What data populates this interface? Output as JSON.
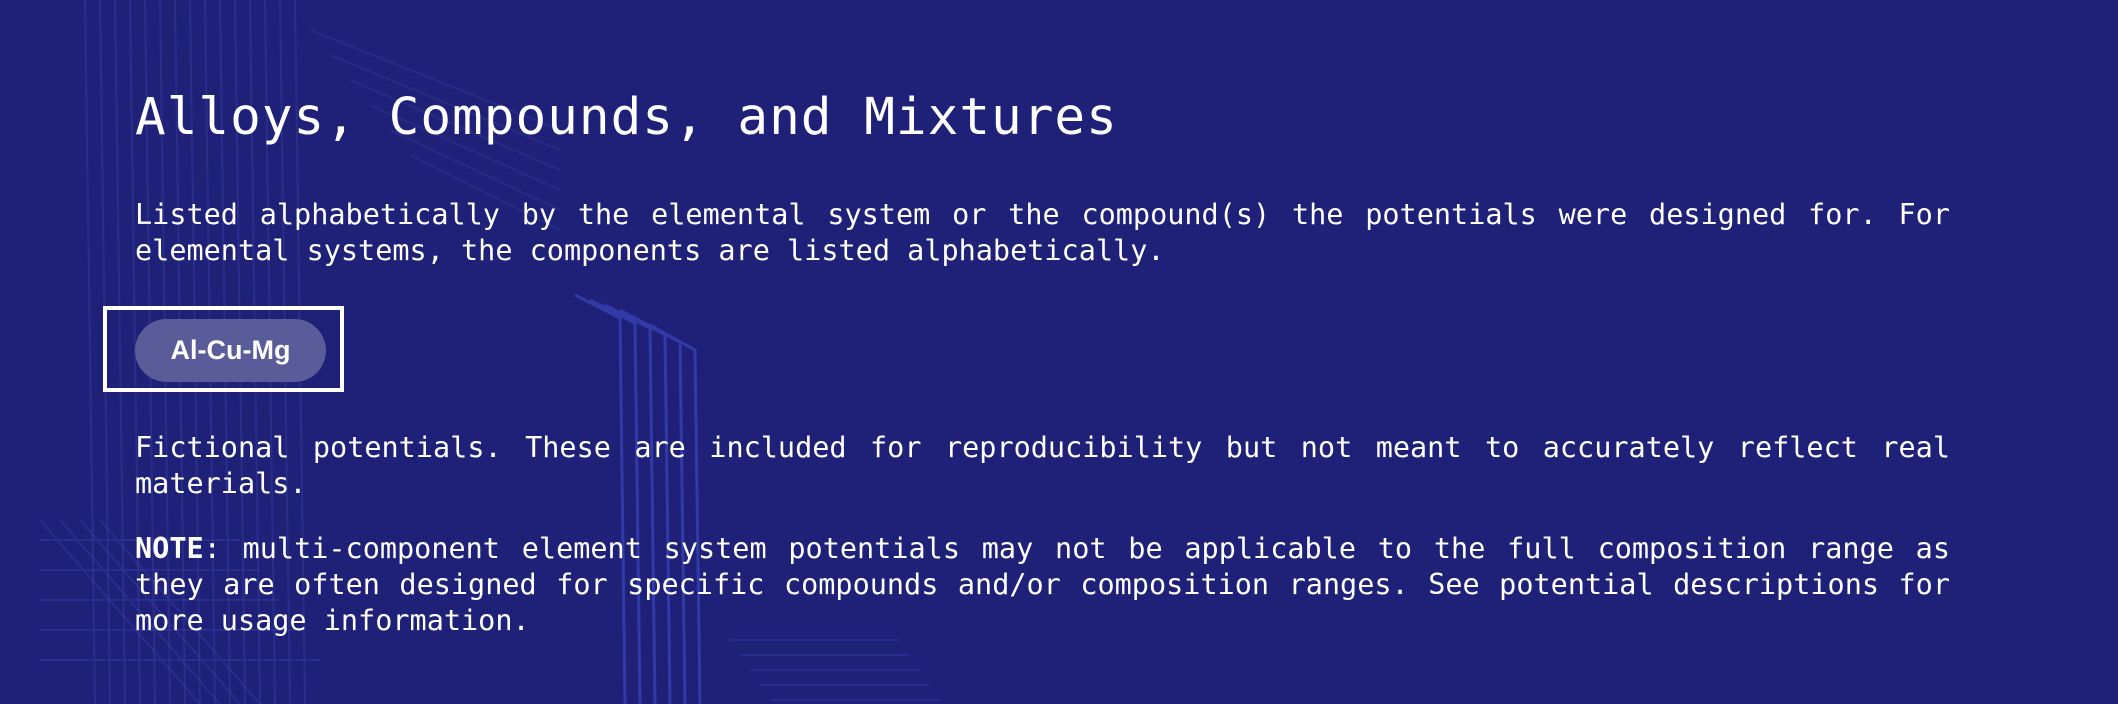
{
  "section": {
    "title": "Alloys, Compounds, and Mixtures",
    "intro": "Listed alphabetically by the elemental system or the compound(s) the potentials were designed for. For elemental systems, the components are listed alphabetically."
  },
  "tags": [
    {
      "label": "Al-Cu-Mg"
    }
  ],
  "description": "Fictional potentials. These are included for reproducibility but not meant to accurately reflect real materials.",
  "note": {
    "label": "NOTE",
    "text": ": multi-component element system potentials may not be applicable to the full composition range as they are often designed for specific compounds and/or composition ranges. See potential descriptions for more usage information."
  },
  "colors": {
    "background": "#1e2177",
    "tag_fill": "#5a5c9a",
    "text": "#ffffff",
    "pattern_line": "#3a45c8"
  },
  "icons": [
    "background-line-pattern"
  ]
}
